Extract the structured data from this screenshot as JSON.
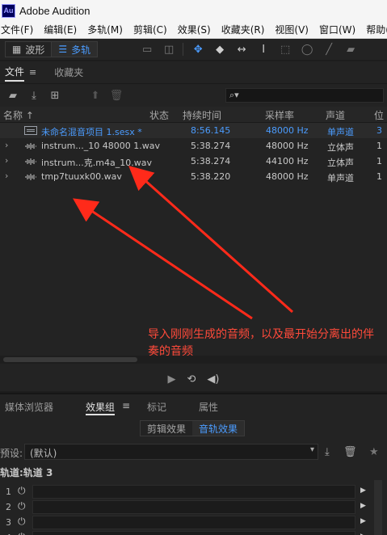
{
  "window": {
    "logo_text": "Au",
    "title": "Adobe Audition"
  },
  "menu": [
    "文件(F)",
    "编辑(E)",
    "多轨(M)",
    "剪辑(C)",
    "效果(S)",
    "收藏夹(R)",
    "视图(V)",
    "窗口(W)",
    "帮助(H"
  ],
  "toolbar": {
    "waveform_label": "波形",
    "multitrack_label": "多轨"
  },
  "files_panel": {
    "tabs": [
      "文件",
      "收藏夹"
    ],
    "search_placeholder": "",
    "columns": [
      "名称",
      "状态",
      "持续时间",
      "采样率",
      "声道",
      "位"
    ],
    "rows": [
      {
        "name": "未命名混音项目 1.sesx *",
        "status": "",
        "duration": "8:56.145",
        "sample_rate": "48000 Hz",
        "channels": "单声道",
        "bits": "3",
        "type": "session"
      },
      {
        "name": "instrum..._10 48000 1.wav",
        "status": "",
        "duration": "5:38.274",
        "sample_rate": "48000 Hz",
        "channels": "立体声",
        "bits": "1",
        "type": "audio"
      },
      {
        "name": "instrum...克.m4a_10.wav",
        "status": "",
        "duration": "5:38.274",
        "sample_rate": "44100 Hz",
        "channels": "立体声",
        "bits": "1",
        "type": "audio"
      },
      {
        "name": "tmp7tuuxk00.wav",
        "status": "",
        "duration": "5:38.220",
        "sample_rate": "48000 Hz",
        "channels": "单声道",
        "bits": "1",
        "type": "audio"
      }
    ]
  },
  "annotation": {
    "text": "导入刚刚生成的音频，以及最开始分离出的伴奏的音频"
  },
  "effects_panel": {
    "tabs": [
      "媒体浏览器",
      "效果组",
      "标记",
      "属性"
    ],
    "subtabs": [
      "剪辑效果",
      "音轨效果"
    ],
    "preset_label": "预设:",
    "preset_value": "(默认)",
    "track_label": "轨道:轨道 3",
    "slots": [
      "1",
      "2",
      "3",
      "4"
    ]
  },
  "colors": {
    "accent": "#4b9cff",
    "annotation": "#ff3b30",
    "panel_bg": "#232323"
  }
}
